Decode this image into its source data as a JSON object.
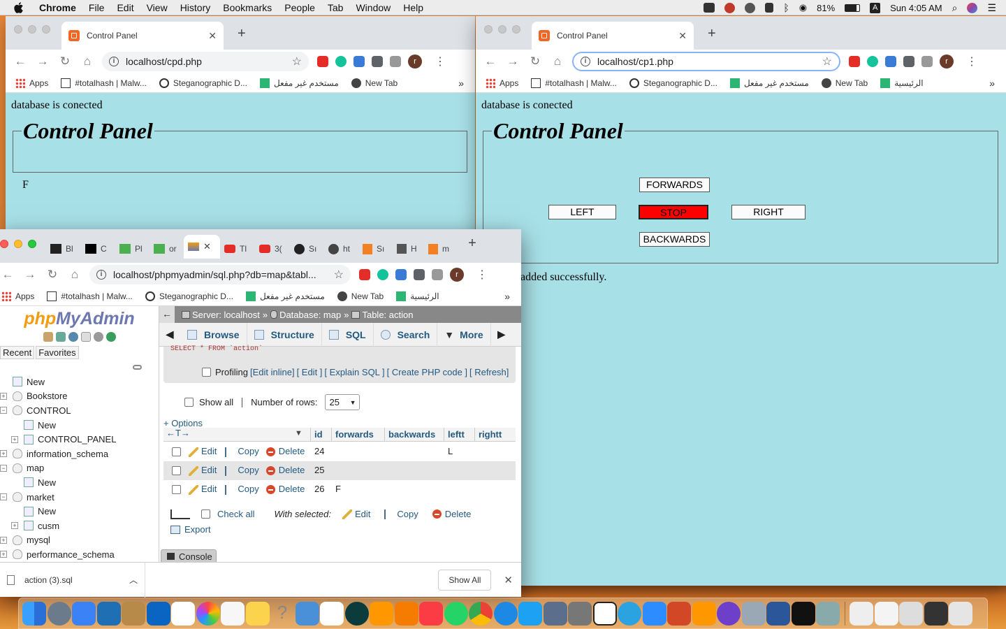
{
  "menubar": {
    "app": "Chrome",
    "items": [
      "File",
      "Edit",
      "View",
      "History",
      "Bookmarks",
      "People",
      "Tab",
      "Window",
      "Help"
    ],
    "battery": "81%",
    "clock": "Sun 4:05 AM"
  },
  "bookmarks": {
    "apps": "Apps",
    "totalhash": "#totalhash | Malw...",
    "stego": "Steganographic D...",
    "arabic1": "مستخدم غير مفعل",
    "newtab": "New Tab",
    "arabic2": "الرئيسية",
    "more": "»"
  },
  "win1": {
    "tab_title": "Control Panel",
    "url": "localhost/cpd.php",
    "db_msg": "database is conected",
    "legend": "Control Panel",
    "value": "F"
  },
  "win2": {
    "tab_title": "Control Panel",
    "url": "localhost/cp1.php",
    "db_msg": "database is conected",
    "legend": "Control Panel",
    "buttons": {
      "forwards": "FORWARDS",
      "left": "LEFT",
      "stop": "STOP",
      "right": "RIGHT",
      "backwards": "BACKWARDS"
    },
    "status": "added successfully."
  },
  "pma": {
    "tabs": [
      "Bl",
      "C",
      "Pl",
      "or",
      "",
      "Tl",
      "3(",
      "Sı",
      "ht",
      "Sı",
      "H",
      "m"
    ],
    "url": "localhost/phpmyadmin/sql.php?db=map&tabl...",
    "logo_php": "php",
    "logo_myadmin": "MyAdmin",
    "recent": "Recent",
    "favorites": "Favorites",
    "tree": [
      {
        "label": "New",
        "level": 0,
        "type": "new"
      },
      {
        "label": "Bookstore",
        "level": 0,
        "type": "db"
      },
      {
        "label": "CONTROL",
        "level": 0,
        "type": "db"
      },
      {
        "label": "New",
        "level": 1,
        "type": "new"
      },
      {
        "label": "CONTROL_PANEL",
        "level": 1,
        "type": "table"
      },
      {
        "label": "information_schema",
        "level": 0,
        "type": "db"
      },
      {
        "label": "map",
        "level": 0,
        "type": "db"
      },
      {
        "label": "New",
        "level": 1,
        "type": "new"
      },
      {
        "label": "market",
        "level": 0,
        "type": "db"
      },
      {
        "label": "New",
        "level": 1,
        "type": "new"
      },
      {
        "label": "cusm",
        "level": 1,
        "type": "table"
      },
      {
        "label": "mysql",
        "level": 0,
        "type": "db"
      },
      {
        "label": "performance_schema",
        "level": 0,
        "type": "db"
      }
    ],
    "breadcrumb": {
      "server": "Server: localhost",
      "database": "Database: map",
      "table": "Table: action"
    },
    "nav": {
      "browse": "Browse",
      "structure": "Structure",
      "sql": "SQL",
      "search": "Search",
      "more": "More"
    },
    "query": "SELECT * FROM `action`",
    "profiling": "Profiling",
    "links": [
      "[Edit inline]",
      "[ Edit ]",
      "[ Explain SQL ]",
      "[ Create PHP code ]",
      "[ Refresh]"
    ],
    "show_all": "Show all",
    "rows_label": "Number of rows:",
    "rows_value": "25",
    "options": "+ Options",
    "columns": [
      "id",
      "forwards",
      "backwards",
      "leftt",
      "rightt"
    ],
    "row_actions": {
      "edit": "Edit",
      "copy": "Copy",
      "delete": "Delete"
    },
    "rows": [
      {
        "id": "24",
        "forwards": "",
        "backwards": "",
        "leftt": "L",
        "rightt": ""
      },
      {
        "id": "25",
        "forwards": "",
        "backwards": "",
        "leftt": "",
        "rightt": ""
      },
      {
        "id": "26",
        "forwards": "F",
        "backwards": "",
        "leftt": "",
        "rightt": ""
      }
    ],
    "check_all": "Check all",
    "with_selected": "With selected:",
    "export": "Export",
    "console": "Console"
  },
  "downloads": {
    "file": "action (3).sql",
    "show_all": "Show All"
  }
}
